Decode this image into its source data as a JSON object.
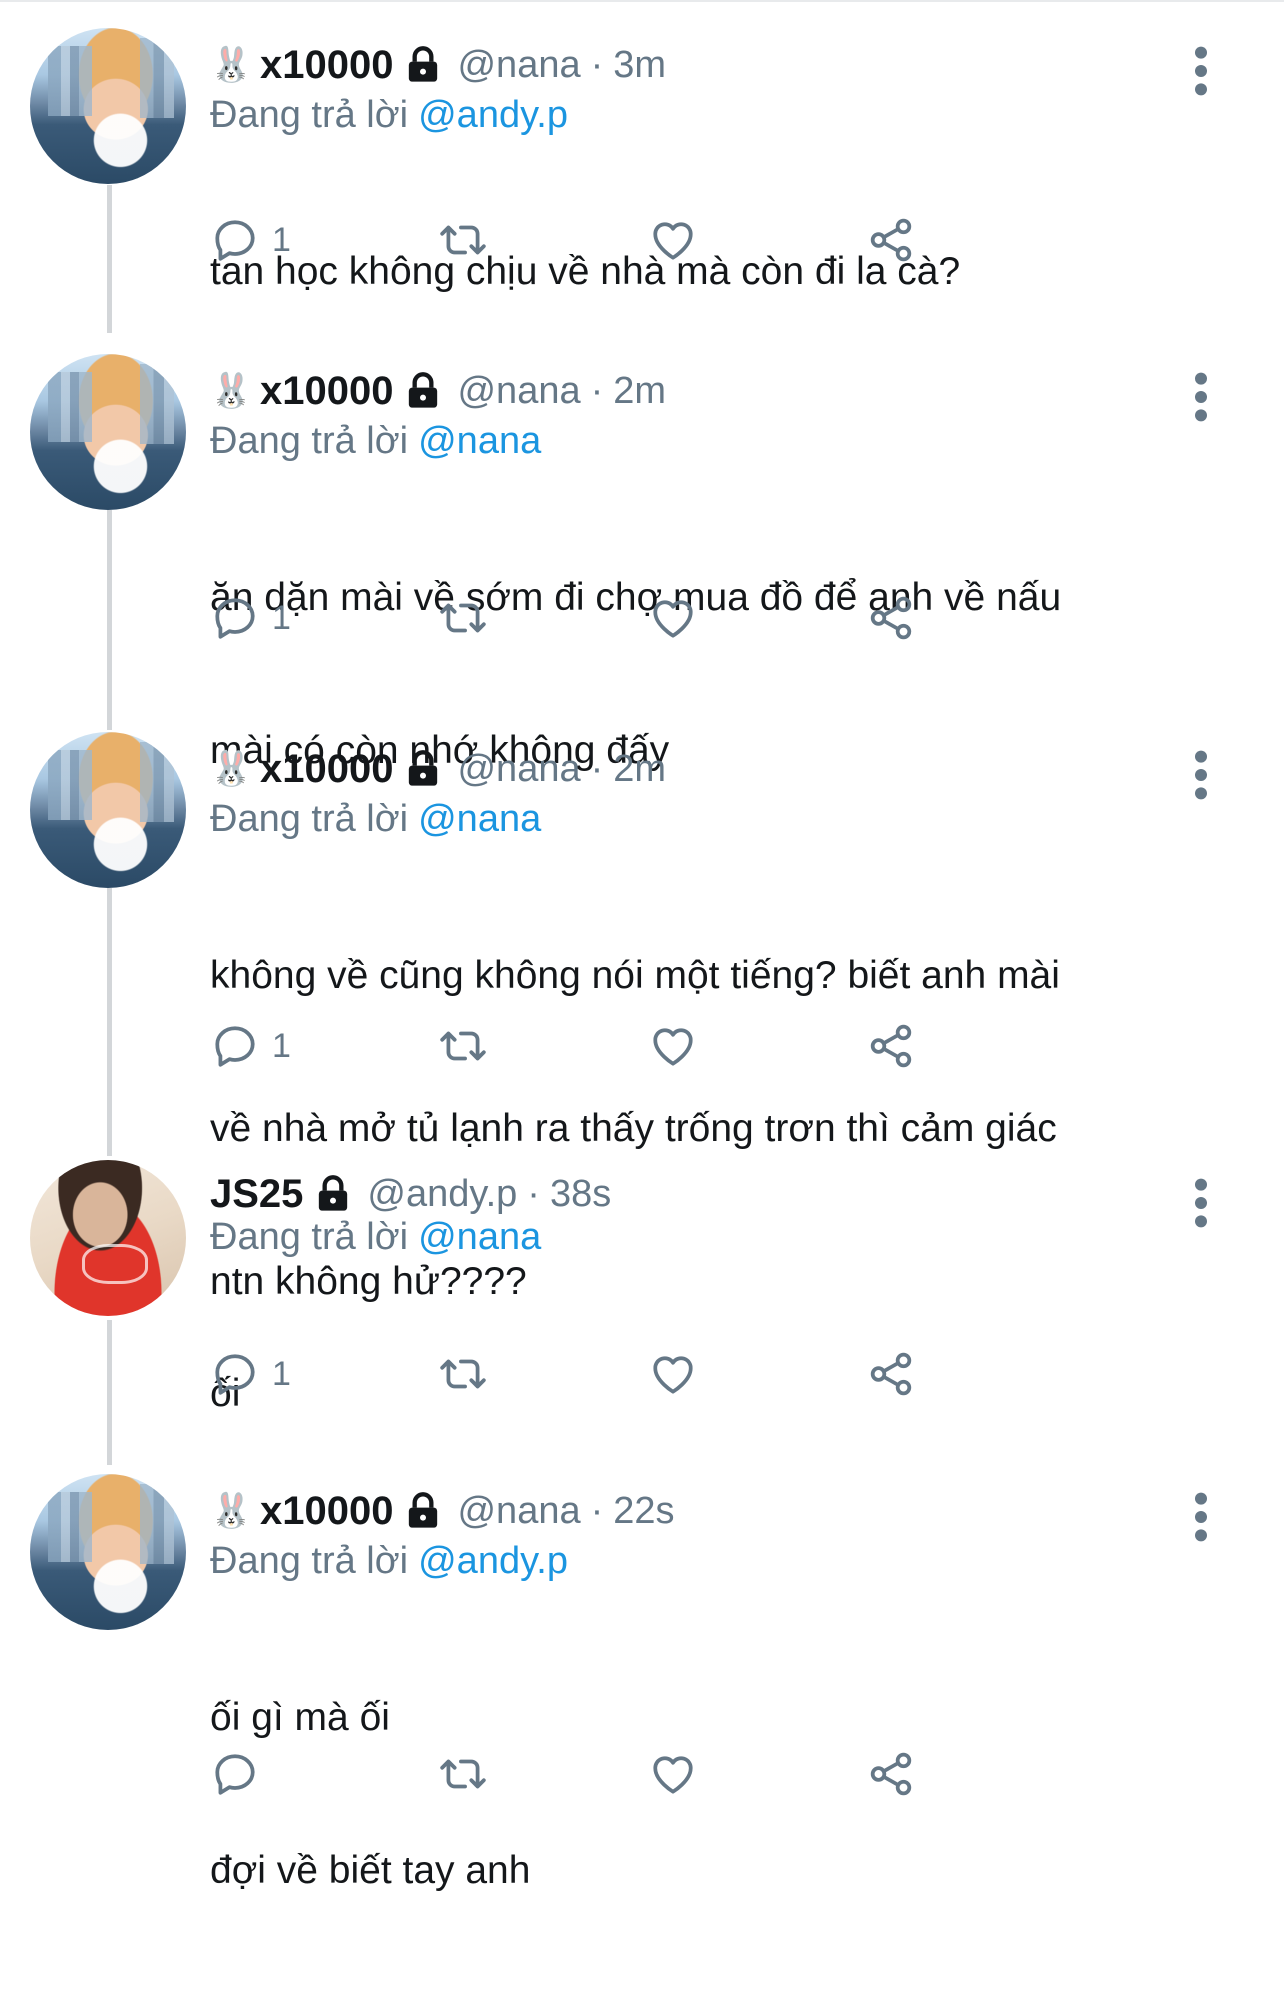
{
  "tweets": [
    {
      "avatar": "avatar-city-boy",
      "emoji": "🐰",
      "display_name": "x10000",
      "handle": "@nana",
      "separator": "·",
      "time": "3m",
      "replying_label": "Đang trả lời",
      "replying_to": "@andy.p",
      "lines": [
        "tan học không chịu về nhà mà còn đi la cà?"
      ],
      "reply_count": "1"
    },
    {
      "avatar": "avatar-city-boy",
      "emoji": "🐰",
      "display_name": "x10000",
      "handle": "@nana",
      "separator": "·",
      "time": "2m",
      "replying_label": "Đang trả lời",
      "replying_to": "@nana",
      "lines": [
        "ăn dặn mài về sớm đi chợ mua đồ để anh về nấu",
        "mài có còn nhớ không đấy"
      ],
      "reply_count": "1"
    },
    {
      "avatar": "avatar-city-boy",
      "emoji": "🐰",
      "display_name": "x10000",
      "handle": "@nana",
      "separator": "·",
      "time": "2m",
      "replying_label": "Đang trả lời",
      "replying_to": "@nana",
      "lines": [
        "không về cũng không nói một tiếng? biết anh mài",
        "về nhà mở tủ lạnh ra thấy trống trơn thì cảm giác",
        "ntn không hử????"
      ],
      "reply_count": "1"
    },
    {
      "avatar": "avatar-red-shirt",
      "emoji": "",
      "display_name": "JS25",
      "handle": "@andy.p",
      "separator": "·",
      "time": "38s",
      "replying_label": "Đang trả lời",
      "replying_to": "@nana",
      "lines": [
        "ối"
      ],
      "reply_count": "1"
    },
    {
      "avatar": "avatar-city-boy",
      "emoji": "🐰",
      "display_name": "x10000",
      "handle": "@nana",
      "separator": "·",
      "time": "22s",
      "replying_label": "Đang trả lời",
      "replying_to": "@andy.p",
      "lines": [
        "ối gì mà ối",
        "đợi về biết tay anh"
      ],
      "reply_count": ""
    }
  ],
  "icons": {
    "reply": "reply-icon",
    "retweet": "retweet-icon",
    "like": "heart-icon",
    "share": "share-icon",
    "more": "more-vertical-icon",
    "lock": "lock-icon"
  },
  "colors": {
    "text": "#14171a",
    "secondary": "#657786",
    "mention": "#1b95e0",
    "thread_line": "#d3d6d9"
  }
}
